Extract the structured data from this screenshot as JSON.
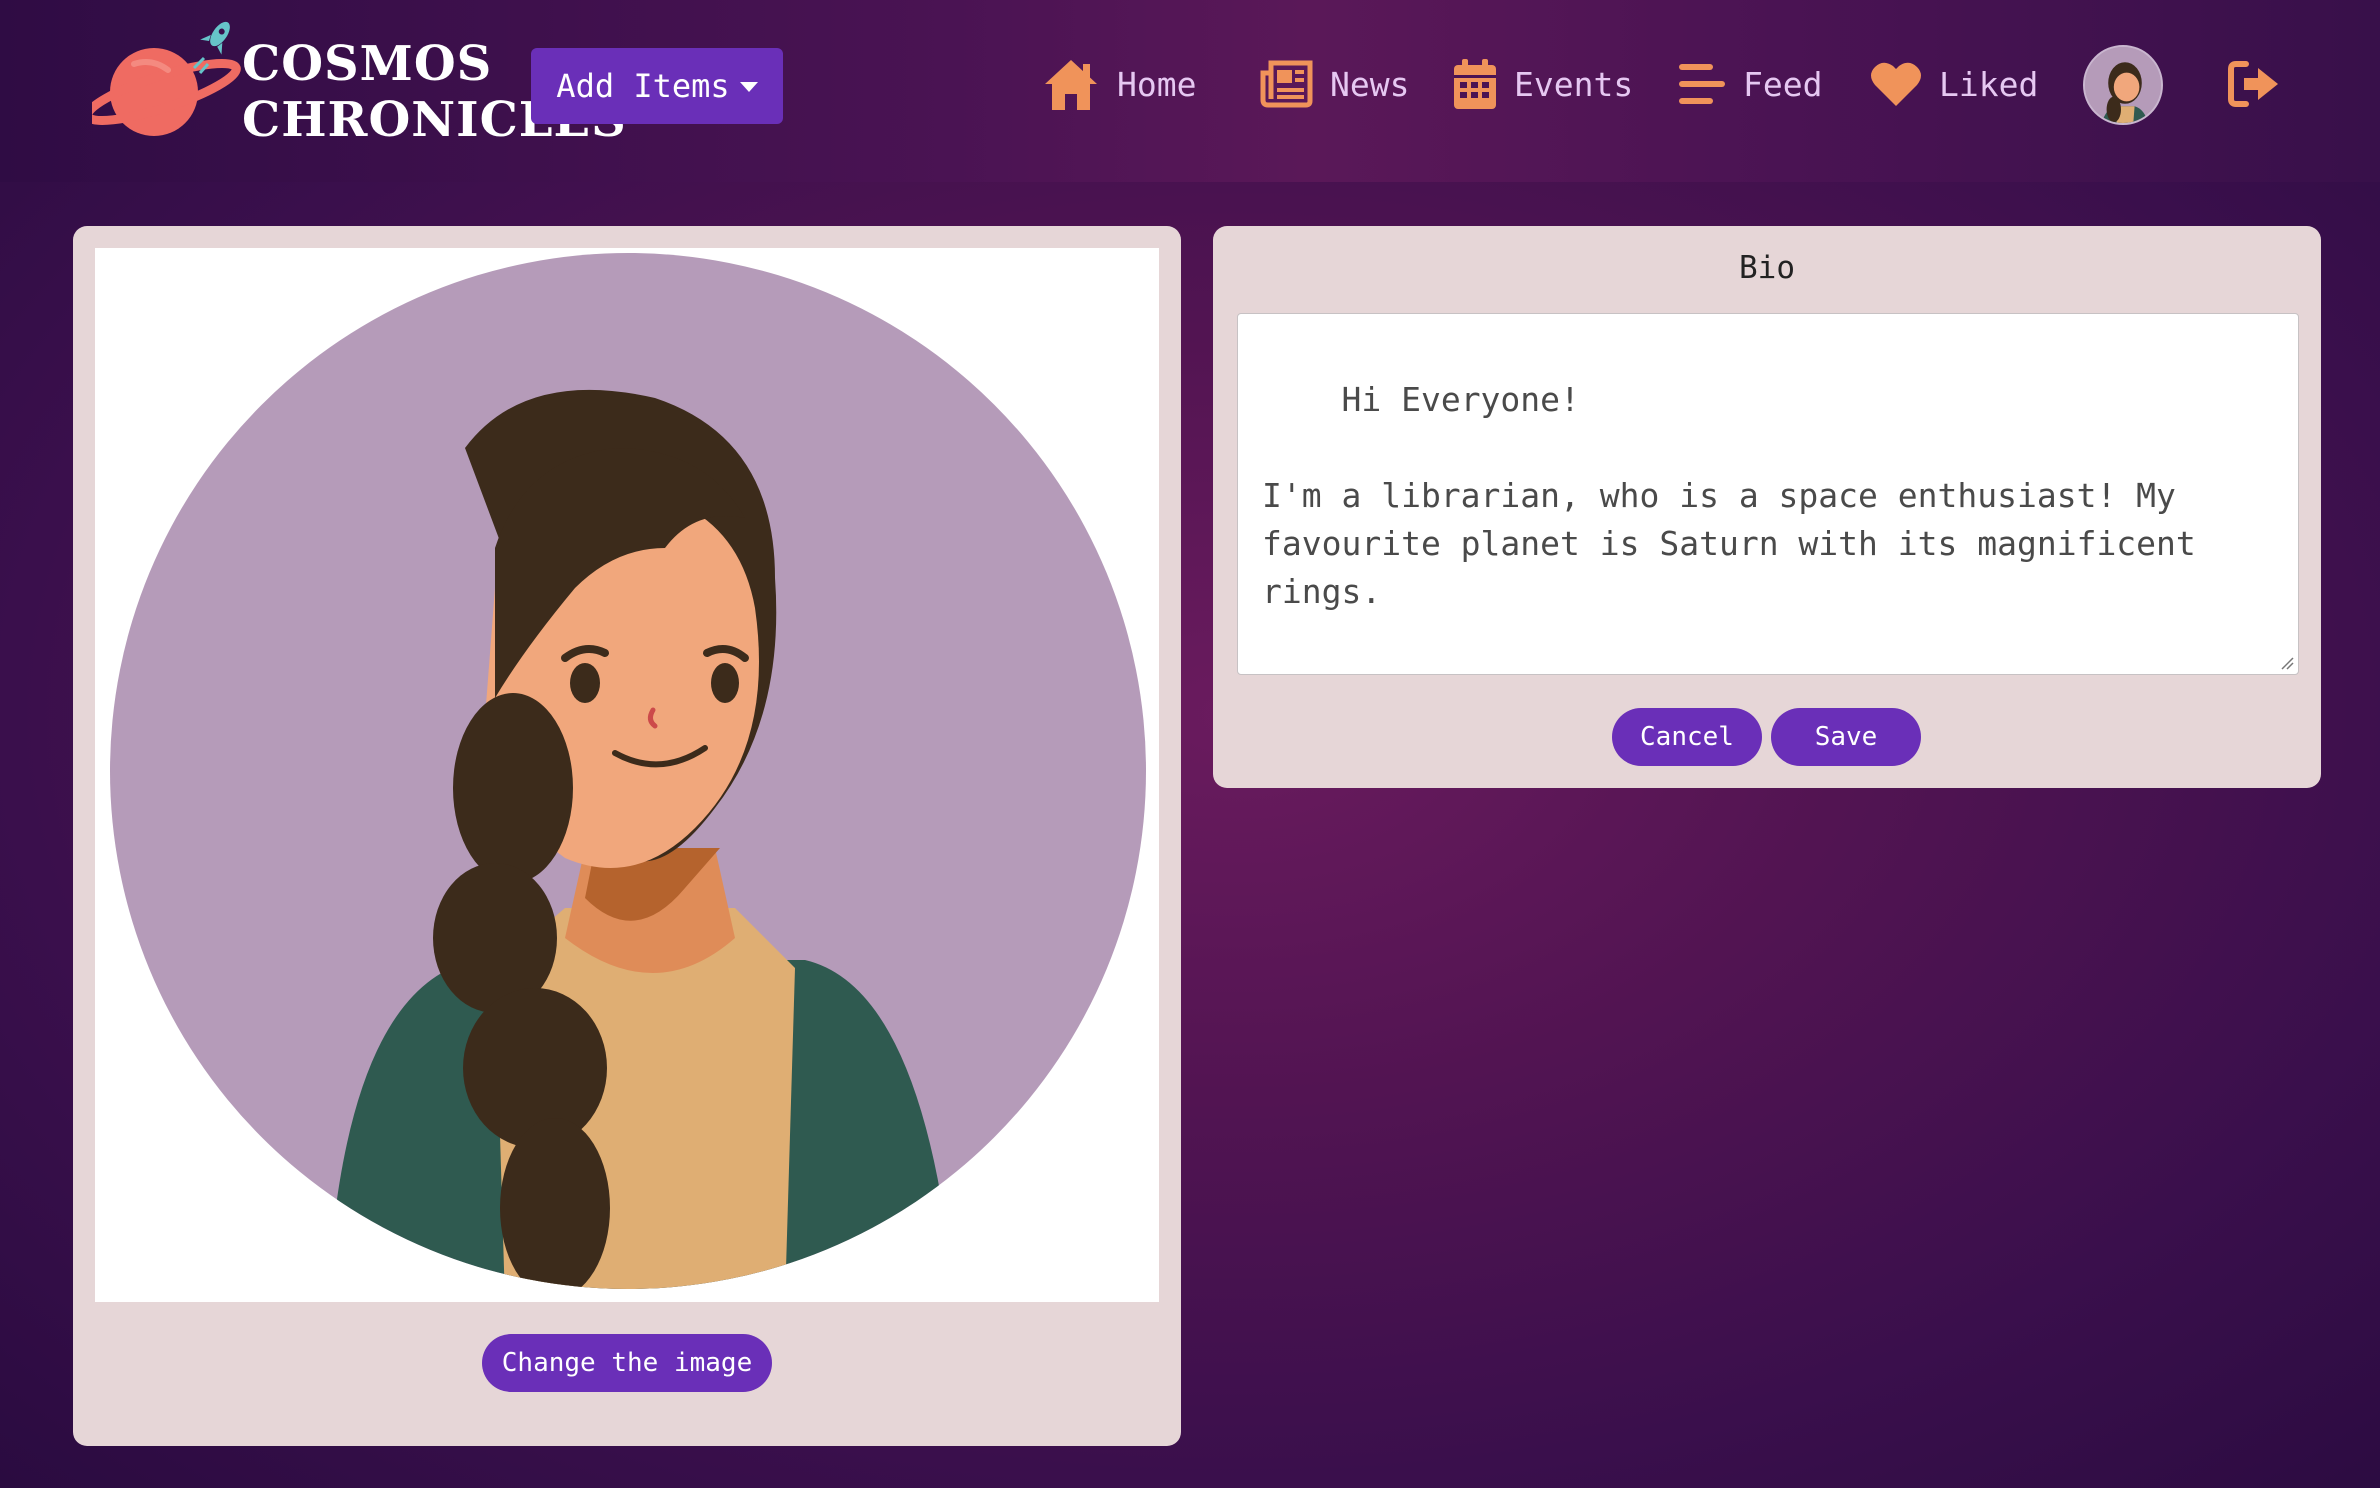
{
  "brand": {
    "line1": "COSMOS",
    "line2": "CHRONICLES",
    "logo_icon": "planet-rocket-icon"
  },
  "header": {
    "add_items_label": "Add Items",
    "nav": [
      {
        "label": "Home",
        "icon": "home-icon"
      },
      {
        "label": "News",
        "icon": "newspaper-icon"
      },
      {
        "label": "Events",
        "icon": "calendar-icon"
      },
      {
        "label": "Feed",
        "icon": "feed-lines-icon"
      },
      {
        "label": "Liked",
        "icon": "heart-icon"
      }
    ],
    "logout_icon": "logout-icon"
  },
  "profile": {
    "change_image_label": "Change the image"
  },
  "bio": {
    "title": "Bio",
    "text": "Hi Everyone!\n\nI'm a librarian, who is a space enthusiast! My favourite planet is Saturn with its magnificent rings.",
    "cancel_label": "Cancel",
    "save_label": "Save"
  },
  "colors": {
    "accent": "#6a2fb8",
    "icon_orange": "#f0935a",
    "card_bg": "#e6d6d7"
  }
}
